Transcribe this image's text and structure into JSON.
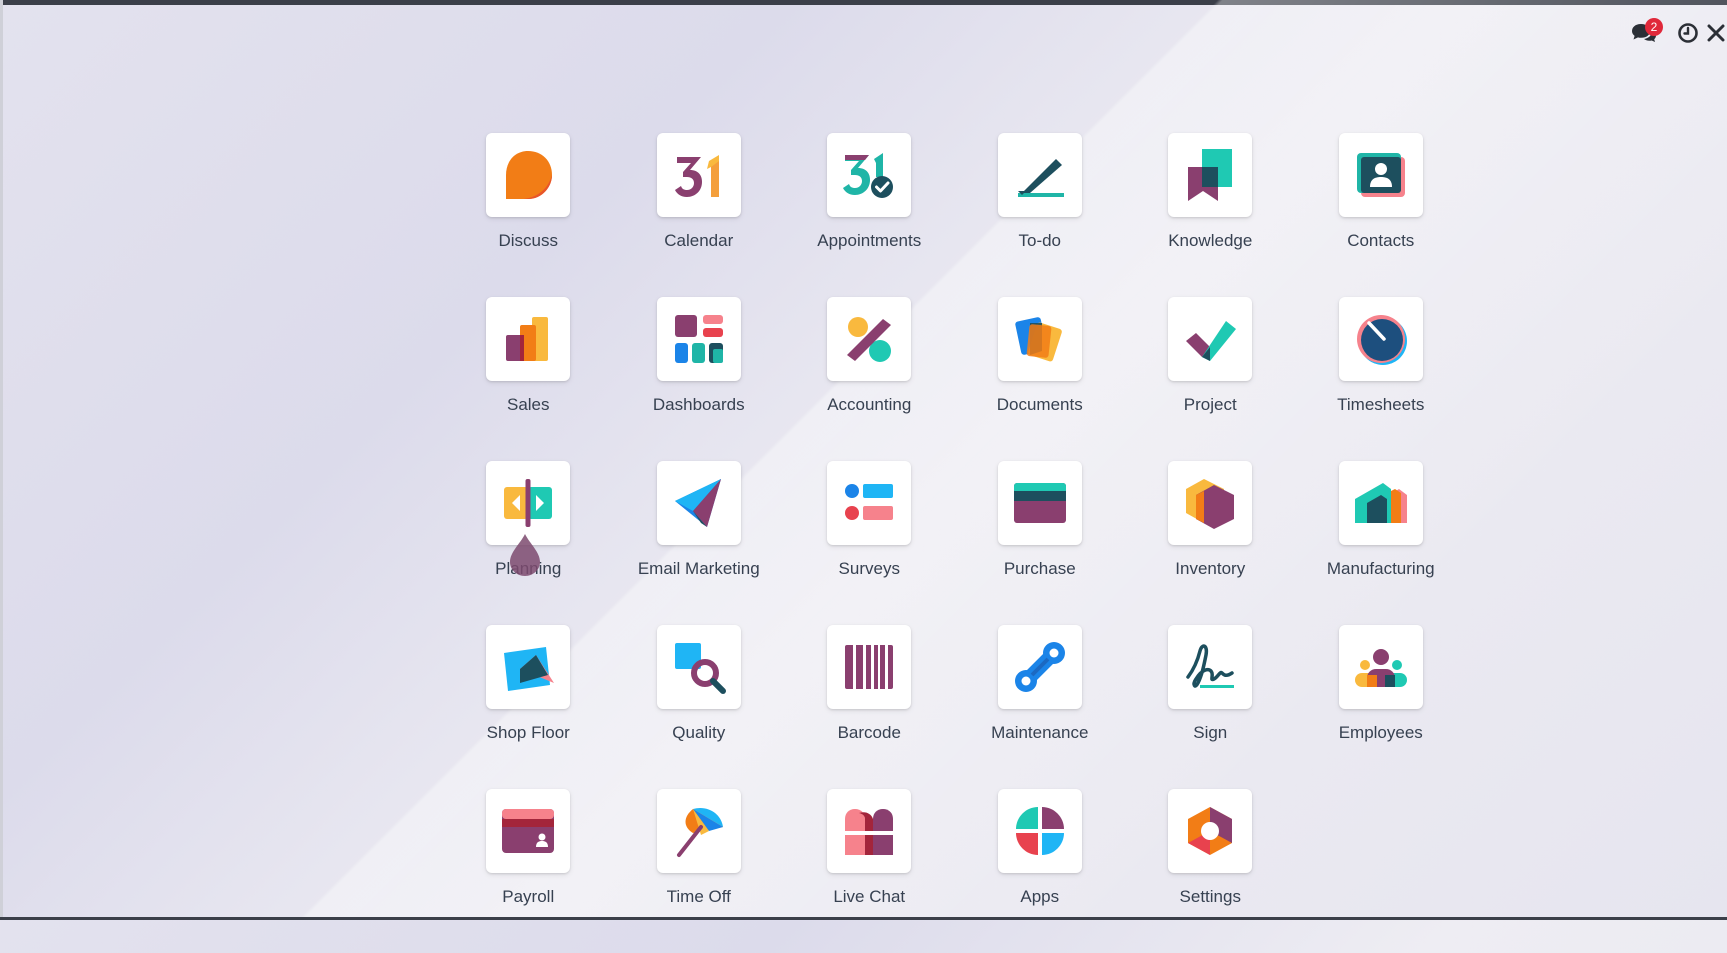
{
  "systray": {
    "messages_badge": "2",
    "icons": [
      "chat-bubbles-icon",
      "clock-icon",
      "close-icon"
    ]
  },
  "apps": [
    {
      "label": "Discuss",
      "icon": "discuss-icon"
    },
    {
      "label": "Calendar",
      "icon": "calendar-icon"
    },
    {
      "label": "Appointments",
      "icon": "appointments-icon"
    },
    {
      "label": "To-do",
      "icon": "todo-icon"
    },
    {
      "label": "Knowledge",
      "icon": "knowledge-icon"
    },
    {
      "label": "Contacts",
      "icon": "contacts-icon"
    },
    {
      "label": "Sales",
      "icon": "sales-icon"
    },
    {
      "label": "Dashboards",
      "icon": "dashboards-icon"
    },
    {
      "label": "Accounting",
      "icon": "accounting-icon"
    },
    {
      "label": "Documents",
      "icon": "documents-icon"
    },
    {
      "label": "Project",
      "icon": "project-icon"
    },
    {
      "label": "Timesheets",
      "icon": "timesheets-icon"
    },
    {
      "label": "Planning",
      "icon": "planning-icon"
    },
    {
      "label": "Email Marketing",
      "icon": "email-marketing-icon"
    },
    {
      "label": "Surveys",
      "icon": "surveys-icon"
    },
    {
      "label": "Purchase",
      "icon": "purchase-icon"
    },
    {
      "label": "Inventory",
      "icon": "inventory-icon"
    },
    {
      "label": "Manufacturing",
      "icon": "manufacturing-icon"
    },
    {
      "label": "Shop Floor",
      "icon": "shop-floor-icon"
    },
    {
      "label": "Quality",
      "icon": "quality-icon"
    },
    {
      "label": "Barcode",
      "icon": "barcode-icon"
    },
    {
      "label": "Maintenance",
      "icon": "maintenance-icon"
    },
    {
      "label": "Sign",
      "icon": "sign-icon"
    },
    {
      "label": "Employees",
      "icon": "employees-icon"
    },
    {
      "label": "Payroll",
      "icon": "payroll-icon"
    },
    {
      "label": "Time Off",
      "icon": "time-off-icon"
    },
    {
      "label": "Live Chat",
      "icon": "live-chat-icon"
    },
    {
      "label": "Apps",
      "icon": "apps-icon"
    },
    {
      "label": "Settings",
      "icon": "settings-icon"
    }
  ]
}
